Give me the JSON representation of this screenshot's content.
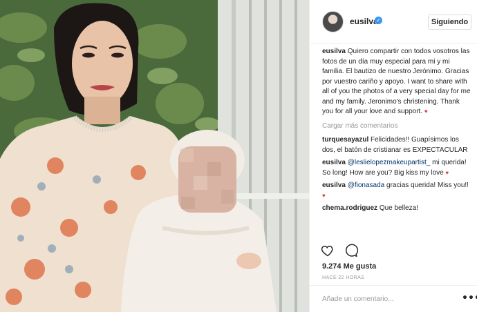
{
  "post": {
    "username": "eusilva",
    "follow_label": "Siguiendo",
    "verified_symbol": "✓",
    "caption": {
      "username": "eusilva",
      "text": "Quiero compartir con todos vosotros las fotos de un día muy especial para mi y mi familia. El bautizo de nuestro Jerónimo. Gracias por vuestro cariño y apoyo. I want to share with all of you the photos of a very special day for me and my family. Jeronimo's christening. Thank you for all your love and support."
    },
    "load_more": "Cargar más comentarios",
    "comments": [
      {
        "username": "turquesayazul",
        "text": "Felicidades!! Guapísimos los dos, el batón de cristianar es EXPECTACULAR"
      },
      {
        "username": "eusilva",
        "mention": "@leslielopezmakeupartist_",
        "text": " mi querida! So long! How are you? Big kiss my love"
      },
      {
        "username": "eusilva",
        "mention": "@fionasada",
        "text": " gracias querida! Miss you!!"
      },
      {
        "username": "chema.rodriguez",
        "text": "Que belleza!"
      }
    ],
    "likes": "9.274 Me gusta",
    "timestamp": "HACE 22 HORAS",
    "add_comment_placeholder": "Añade un comentario...",
    "more_options": "•••",
    "icons": [
      "heart-icon",
      "comment-icon",
      "verified-icon",
      "more-options-icon"
    ]
  },
  "colors": {
    "text": "#262626",
    "secondary": "#999999",
    "mention": "#003569",
    "verified": "#3897f0",
    "border": "#dbdbdb"
  }
}
